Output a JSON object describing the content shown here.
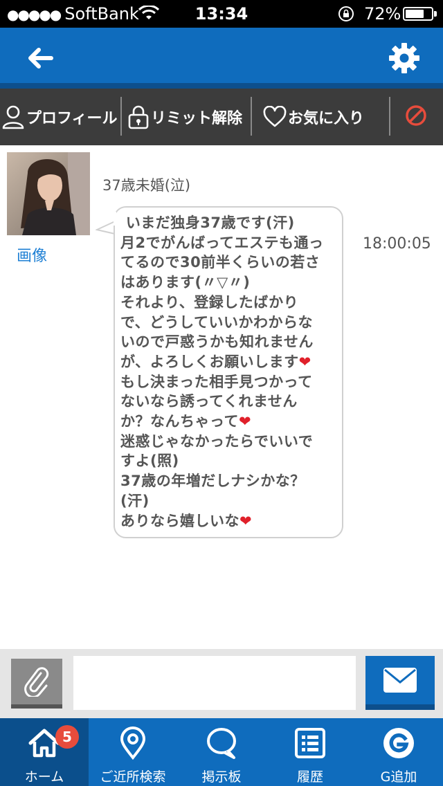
{
  "status_bar": {
    "carrier": "SoftBank",
    "time": "13:34",
    "battery": "72%",
    "battery_level": 0.72
  },
  "header": {
    "back_icon": "arrow-left-icon",
    "settings_icon": "gear-icon"
  },
  "actions": {
    "profile": "プロフィール",
    "limit": "リミット解除",
    "favorite": "お気に入り",
    "block_icon": "prohibit-icon"
  },
  "message": {
    "sender": "37歳未婚(泣)",
    "image_link": "画像",
    "time": "18:00:05",
    "lines": [
      " いまだ独身37歳です(汗)",
      "月2でがんばってエステも通っ",
      "てるので30前半くらいの若さ",
      "はあります(〃▽〃)",
      "それより、登録したばかり",
      "で、どうしていいかわからな",
      "いので戸惑うかも知れません",
      "が、よろしくお願いします",
      "もし決まった相手見つかって",
      "ないなら誘ってくれません",
      "か？なんちゃって",
      "迷惑じゃなかったらでいいで",
      "すよ(照)",
      "37歳の年増だしナシかな？",
      "(汗)",
      "ありなら嬉しいな"
    ],
    "heart_lines": [
      7,
      10,
      15
    ]
  },
  "compose": {
    "placeholder": "",
    "attach_icon": "paperclip-icon",
    "send_icon": "envelope-icon"
  },
  "tabs": [
    {
      "label": "ホーム",
      "icon": "home-icon",
      "badge": "5"
    },
    {
      "label": "ご近所検索",
      "icon": "location-pin-icon"
    },
    {
      "label": "掲示板",
      "icon": "speech-bubble-icon"
    },
    {
      "label": "履歴",
      "icon": "list-icon"
    },
    {
      "label": "G追加",
      "icon": "g-circle-icon"
    }
  ],
  "colors": {
    "primary": "#0f6cbd",
    "primary_dark": "#0d4f8c",
    "action_bar": "#3c3c3c",
    "badge": "#e74c3c",
    "heart": "#e0202a",
    "link": "#1d7fd4"
  }
}
